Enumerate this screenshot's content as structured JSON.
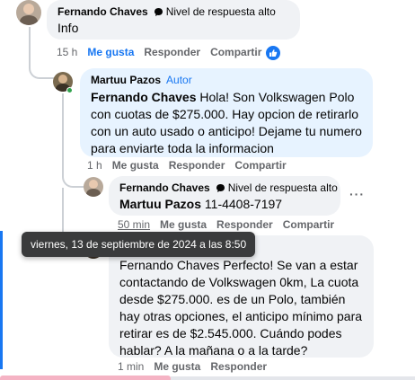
{
  "comments": [
    {
      "author": "Fernando Chaves",
      "badge": "Nivel de respuesta alto",
      "text": "Info",
      "time": "15 h",
      "like": "Me gusta",
      "reply": "Responder",
      "share": "Compartir"
    },
    {
      "author": "Martuu Pazos",
      "author_tag": "Autor",
      "mention": "Fernando Chaves",
      "text": "Hola! Son Volkswagen Polo con cuotas de $275.000. Hay opcion de retirarlo con un auto usado o anticipo! Dejame tu numero para enviarte toda la informacion",
      "time": "1 h",
      "like": "Me gusta",
      "reply": "Responder",
      "share": "Compartir"
    },
    {
      "author": "Fernando Chaves",
      "badge": "Nivel de respuesta alto",
      "mention": "Martuu Pazos",
      "text": "11-4408-7197",
      "time": "50 min",
      "like": "Me gusta",
      "reply": "Responder",
      "share": "Compartir",
      "more": "···"
    },
    {
      "mention": "Fernando Chaves",
      "text": "Perfecto! Se van a estar contactando de Volkswagen 0km, La cuota desde $275.000. es de un Polo, también hay otras opciones, el anticipo mínimo para retirar es de $2.545.000. Cuándo podes hablar? A la mañana o a la tarde?",
      "time": "1 min",
      "like": "Me gusta",
      "reply": "Responder"
    }
  ],
  "tooltip": "viernes, 13 de septiembre de 2024 a las 8:50",
  "icons": {
    "badge": "chat-bubble-icon",
    "like_reaction": "thumbs-up-icon",
    "more": "more-options-icon"
  },
  "colors": {
    "link_blue": "#1877f2",
    "bubble_grey": "#f0f2f5",
    "bubble_blue": "#e7f3ff",
    "online_green": "#31a24c"
  }
}
